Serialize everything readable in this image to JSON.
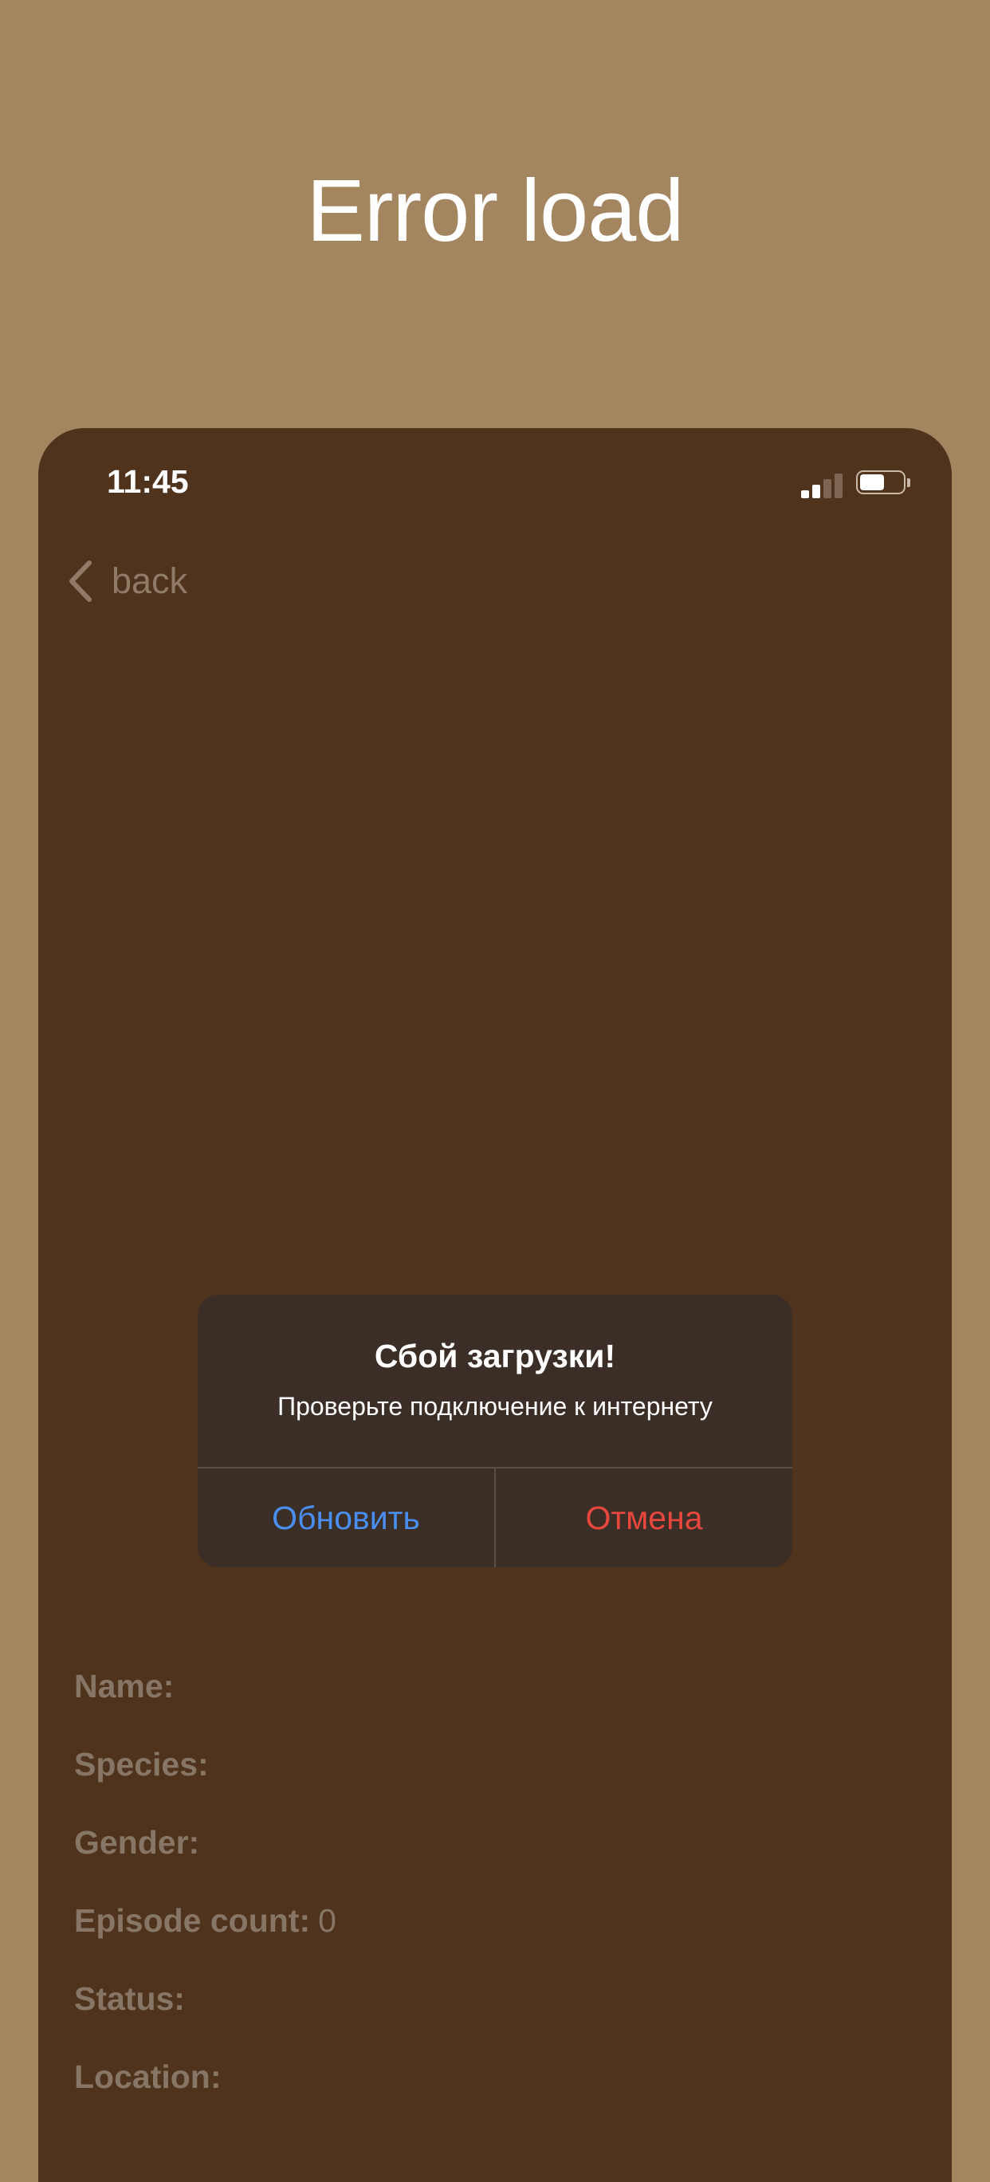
{
  "promo": {
    "title": "Error load"
  },
  "status_bar": {
    "time": "11:45",
    "signal_icon": "cellular-signal-icon",
    "battery_icon": "battery-icon"
  },
  "nav": {
    "back_label": "back",
    "back_icon": "chevron-left-icon"
  },
  "alert": {
    "title": "Сбой загрузки!",
    "message": "Проверьте подключение к интернету",
    "refresh_label": "Обновить",
    "cancel_label": "Отмена",
    "colors": {
      "refresh": "#4A8FF0",
      "cancel": "#E8473D"
    }
  },
  "details": [
    {
      "label": "Name:",
      "value": ""
    },
    {
      "label": "Species:",
      "value": ""
    },
    {
      "label": "Gender:",
      "value": ""
    },
    {
      "label": "Episode count:",
      "value": "0"
    },
    {
      "label": "Status:",
      "value": ""
    },
    {
      "label": "Location:",
      "value": ""
    }
  ],
  "colors": {
    "background": "#A3865F",
    "screen": "#4F331C",
    "alert_background": "#3A2E26"
  }
}
